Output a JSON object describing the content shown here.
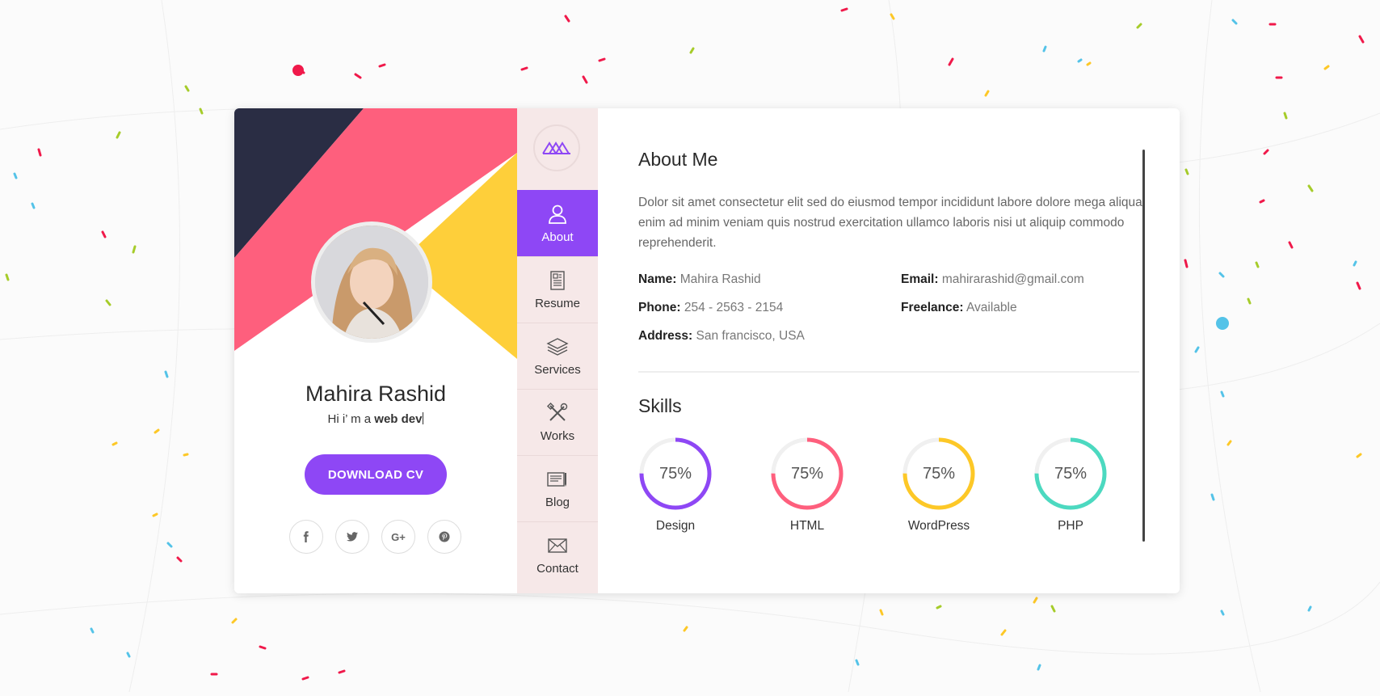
{
  "profile": {
    "name": "Mahira Rashid",
    "tagline_prefix": "Hi i’  m a ",
    "tagline_highlight": "web dev",
    "download_label": "DOWNLOAD CV",
    "socials": [
      {
        "icon": "facebook-icon",
        "glyph": "f"
      },
      {
        "icon": "twitter-icon",
        "glyph": "t"
      },
      {
        "icon": "google-plus-icon",
        "glyph": "G+"
      },
      {
        "icon": "pinterest-icon",
        "glyph": "p"
      }
    ]
  },
  "nav": {
    "items": [
      {
        "label": "About",
        "icon": "user-icon",
        "active": true
      },
      {
        "label": "Resume",
        "icon": "resume-icon",
        "active": false
      },
      {
        "label": "Services",
        "icon": "layers-icon",
        "active": false
      },
      {
        "label": "Works",
        "icon": "tools-icon",
        "active": false
      },
      {
        "label": "Blog",
        "icon": "blog-icon",
        "active": false
      },
      {
        "label": "Contact",
        "icon": "envelope-icon",
        "active": false
      }
    ]
  },
  "about": {
    "title": "About Me",
    "text": "Dolor sit amet consectetur elit sed do eiusmod tempor incididunt labore dolore mega aliqua enim ad minim veniam quis nostrud exercitation ullamco laboris nisi ut aliquip commodo reprehenderit.",
    "name_label": "Name:",
    "name_value": "Mahira Rashid",
    "email_label": "Email:",
    "email_value": "mahirarashid@gmail.com",
    "phone_label": "Phone:",
    "phone_value": "254 - 2563 - 2154",
    "freelance_label": "Freelance:",
    "freelance_value": "Available",
    "address_label": "Address:",
    "address_value": "San francisco, USA"
  },
  "skills": {
    "title": "Skills",
    "items": [
      {
        "name": "Design",
        "percent": 75,
        "percent_text": "75%",
        "color": "#8e47f5"
      },
      {
        "name": "HTML",
        "percent": 75,
        "percent_text": "75%",
        "color": "#fe5f7d"
      },
      {
        "name": "WordPress",
        "percent": 75,
        "percent_text": "75%",
        "color": "#fdc827"
      },
      {
        "name": "PHP",
        "percent": 75,
        "percent_text": "75%",
        "color": "#4cd9c0"
      }
    ]
  },
  "colors": {
    "accent": "#8e47f5",
    "navy": "#2a2d44",
    "pink": "#fe5f7d",
    "yellow": "#fecf3a",
    "nav_bg": "#f6e8e8"
  }
}
